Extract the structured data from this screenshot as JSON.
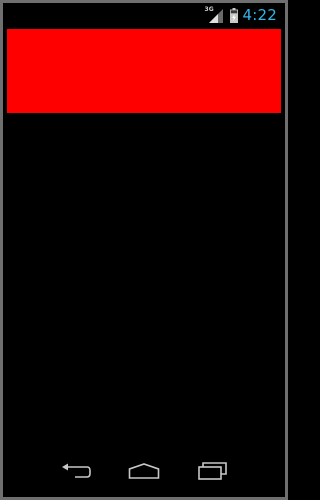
{
  "status_bar": {
    "network_type": "3G",
    "time": "4:22",
    "signal_icon": "signal-icon",
    "battery_icon": "battery-charging-icon"
  },
  "content": {
    "banner_color": "#ff0000"
  },
  "nav_bar": {
    "back_icon": "back-icon",
    "home_icon": "home-icon",
    "recents_icon": "recents-icon"
  },
  "colors": {
    "clock": "#33b5e5",
    "frame": "#6f6f6f",
    "background": "#000000"
  }
}
